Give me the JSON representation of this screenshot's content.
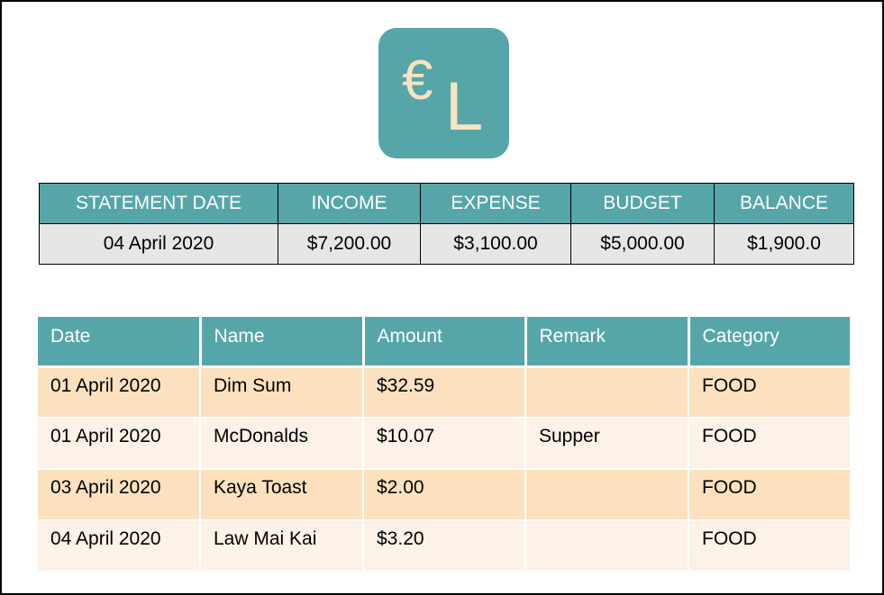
{
  "logo": {
    "symbol": "€",
    "letter": "L"
  },
  "colors": {
    "accent": "#56a6a9",
    "row_dark": "#fde1bf",
    "row_light": "#fdf2e7",
    "summary_row": "#e6e6e6"
  },
  "summary": {
    "headers": [
      "STATEMENT DATE",
      "INCOME",
      "EXPENSE",
      "BUDGET",
      "BALANCE"
    ],
    "values": [
      "04 April 2020",
      "$7,200.00",
      "$3,100.00",
      "$5,000.00",
      "$1,900.0"
    ]
  },
  "transactions": {
    "headers": [
      "Date",
      "Name",
      "Amount",
      "Remark",
      "Category"
    ],
    "rows": [
      [
        "01 April 2020",
        "Dim Sum",
        "$32.59",
        "",
        "FOOD"
      ],
      [
        "01 April 2020",
        "McDonalds",
        "$10.07",
        "Supper",
        "FOOD"
      ],
      [
        "03 April 2020",
        "Kaya Toast",
        "$2.00",
        "",
        "FOOD"
      ],
      [
        "04 April 2020",
        "Law Mai Kai",
        "$3.20",
        "",
        "FOOD"
      ]
    ]
  }
}
